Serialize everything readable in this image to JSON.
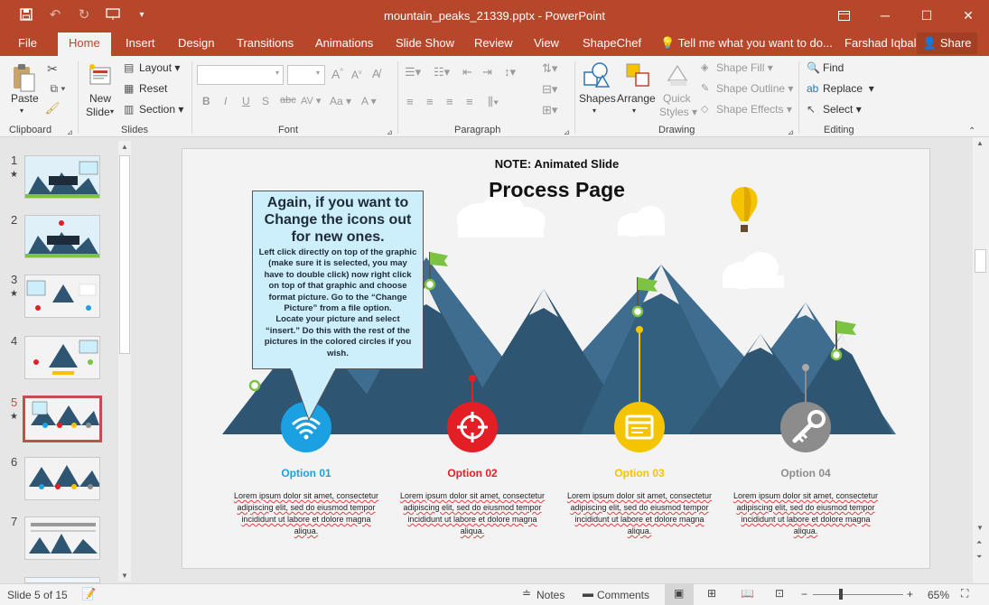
{
  "window": {
    "title": "mountain_peaks_21339.pptx - PowerPoint"
  },
  "tabs": [
    "File",
    "Home",
    "Insert",
    "Design",
    "Transitions",
    "Animations",
    "Slide Show",
    "Review",
    "View",
    "ShapeChef"
  ],
  "active_tab": "Home",
  "tell_me": "Tell me what you want to do...",
  "user": "Farshad Iqbal",
  "share_label": "Share",
  "ribbon": {
    "clipboard": {
      "label": "Clipboard",
      "paste": "Paste"
    },
    "slides": {
      "label": "Slides",
      "new_slide": "New",
      "new_slide_2": "Slide",
      "layout": "Layout",
      "reset": "Reset",
      "section": "Section"
    },
    "font": {
      "label": "Font"
    },
    "paragraph": {
      "label": "Paragraph"
    },
    "drawing": {
      "label": "Drawing",
      "shapes": "Shapes",
      "arrange": "Arrange",
      "quick_styles": "Quick",
      "quick_styles_2": "Styles",
      "shape_fill": "Shape Fill",
      "shape_outline": "Shape Outline",
      "shape_effects": "Shape Effects"
    },
    "editing": {
      "label": "Editing",
      "find": "Find",
      "replace": "Replace",
      "select": "Select"
    }
  },
  "thumbnails": [
    {
      "num": "1",
      "star": true
    },
    {
      "num": "2",
      "star": false
    },
    {
      "num": "3",
      "star": true
    },
    {
      "num": "4",
      "star": false
    },
    {
      "num": "5",
      "star": true,
      "active": true
    },
    {
      "num": "6",
      "star": false
    },
    {
      "num": "7",
      "star": false
    }
  ],
  "slide": {
    "note": "NOTE: Animated Slide",
    "title": "Process Page",
    "callout_heading": "Again, if you want to Change the icons out for new ones.",
    "callout_body_1": "Left click directly on top of the graphic (make sure it is selected, you may have to double click) now right click on top of that graphic and choose format picture. Go to the “Change Picture” from a file option.",
    "callout_body_2": "Locate your picture and select “insert.” Do this with the rest of the pictures in the colored circles if you wish.",
    "options": [
      {
        "title": "Option 01",
        "color": "#1ba1e2",
        "body": "Lorem ipsum dolor sit amet, consectetur adipiscing elit, sed do eiusmod tempor incididunt ut labore et dolore magna aliqua.",
        "icon": "wifi-icon"
      },
      {
        "title": "Option 02",
        "color": "#e31e24",
        "body": "Lorem ipsum dolor sit amet, consectetur adipiscing elit, sed do eiusmod tempor incididunt ut labore et dolore magna aliqua.",
        "icon": "crosshair-icon"
      },
      {
        "title": "Option 03",
        "color": "#f5c400",
        "body": "Lorem ipsum dolor sit amet, consectetur adipiscing elit, sed do eiusmod tempor incididunt ut labore et dolore magna aliqua.",
        "icon": "browser-window-icon"
      },
      {
        "title": "Option 04",
        "color": "#8c8c8c",
        "body": "Lorem ipsum dolor sit amet, consectetur adipiscing elit, sed do eiusmod tempor incididunt ut labore et dolore magna aliqua.",
        "icon": "key-icon"
      }
    ]
  },
  "status": {
    "slide_info": "Slide 5 of 15",
    "notes": "Notes",
    "comments": "Comments",
    "zoom": "65%"
  },
  "colors": {
    "accent": "#b7472a",
    "mountain": "#2e5572",
    "mountain_light": "#3f6d8f",
    "flag": "#7cc243"
  }
}
